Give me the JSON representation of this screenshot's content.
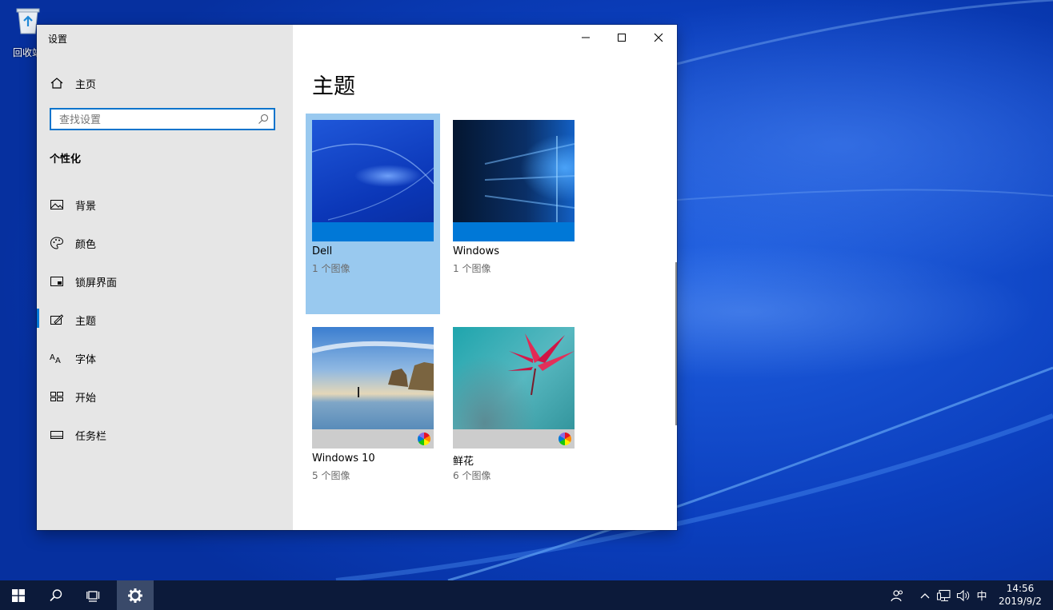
{
  "desktop": {
    "recycle_bin_label": "回收站"
  },
  "window": {
    "title": "设置",
    "sidebar": {
      "home_label": "主页",
      "search_placeholder": "查找设置",
      "section_title": "个性化",
      "items": [
        {
          "label": "背景",
          "icon": "picture-icon"
        },
        {
          "label": "颜色",
          "icon": "palette-icon"
        },
        {
          "label": "锁屏界面",
          "icon": "lock-screen-icon"
        },
        {
          "label": "主题",
          "icon": "theme-brush-icon",
          "selected": true
        },
        {
          "label": "字体",
          "icon": "font-icon"
        },
        {
          "label": "开始",
          "icon": "start-tiles-icon"
        },
        {
          "label": "任务栏",
          "icon": "taskbar-icon"
        }
      ]
    },
    "main": {
      "page_title": "主题",
      "themes": [
        {
          "name": "Dell",
          "count": "1 个图像",
          "selected": true
        },
        {
          "name": "Windows",
          "count": "1 个图像"
        },
        {
          "name": "Windows 10",
          "count": "5 个图像"
        },
        {
          "name": "鲜花",
          "count": "6 个图像"
        }
      ]
    }
  },
  "taskbar": {
    "ime_label": "中",
    "time": "14:56",
    "date": "2019/9/2"
  },
  "colors": {
    "accent": "#0078d7",
    "selected_tile": "#99c9ef",
    "sidebar_bg": "#e6e6e6",
    "taskbar_bg": "#0c1a3a"
  }
}
